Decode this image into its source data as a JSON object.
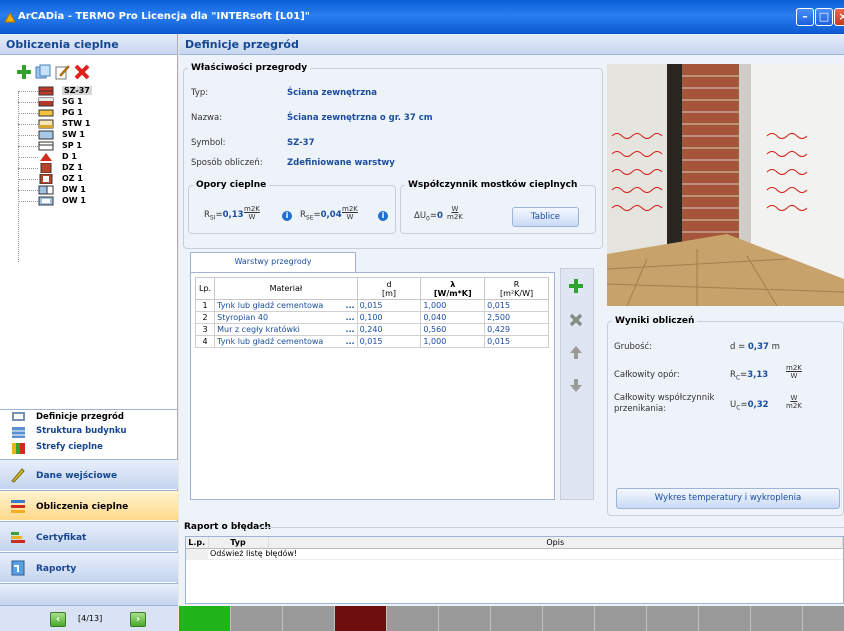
{
  "window": {
    "title": "ArCADia - TERMO Pro Licencja dla \"INTERsoft [L01]\""
  },
  "left_panel": {
    "header": "Obliczenia cieplne",
    "tree": [
      {
        "label": "SZ-37",
        "icon": "wall-icon",
        "selected": true
      },
      {
        "label": "SG 1",
        "icon": "wall-icon"
      },
      {
        "label": "PG 1",
        "icon": "floor-icon"
      },
      {
        "label": "STW 1",
        "icon": "ceiling-icon"
      },
      {
        "label": "SW 1",
        "icon": "internal-wall-icon"
      },
      {
        "label": "SP 1",
        "icon": "slab-icon"
      },
      {
        "label": "D 1",
        "icon": "roof-icon"
      },
      {
        "label": "DZ 1",
        "icon": "door-icon"
      },
      {
        "label": "OZ 1",
        "icon": "window-icon"
      },
      {
        "label": "DW 1",
        "icon": "internal-door-icon"
      },
      {
        "label": "OW 1",
        "icon": "internal-window-icon"
      }
    ],
    "subnav": [
      {
        "label": "Definicje przegród"
      },
      {
        "label": "Struktura budynku"
      },
      {
        "label": "Strefy cieplne"
      }
    ],
    "nav": [
      {
        "label": "Dane wejściowe"
      },
      {
        "label": "Obliczenia cieplne"
      },
      {
        "label": "Certyfikat"
      },
      {
        "label": "Raporty"
      }
    ],
    "pager": "[4/13]"
  },
  "main": {
    "header": "Definicje przegród",
    "properties": {
      "legend": "Właściwości przegrody",
      "type_label": "Typ:",
      "type_value": "Ściana zewnętrzna",
      "name_label": "Nazwa:",
      "name_value": "Ściana zewnętrzna o gr. 37 cm",
      "symbol_label": "Symbol:",
      "symbol_value": "SZ-37",
      "method_label": "Sposób obliczeń:",
      "method_value": "Zdefiniowane warstwy"
    },
    "thermal": {
      "legend": "Opory cieplne",
      "rsi_label": "R",
      "rsi_sub": "SI",
      "rsi_value": "0,13",
      "rsi_unit_num": "m2K",
      "rsi_unit_den": "W",
      "rse_label": "R",
      "rse_sub": "SE",
      "rse_value": "0,04",
      "rse_unit_num": "m2K",
      "rse_unit_den": "W"
    },
    "bridges": {
      "legend": "Współczynnik mostków cieplnych",
      "du_label": "ΔU",
      "du_sub": "0",
      "du_value": "0",
      "du_unit_num": "W",
      "du_unit_den": "m2K",
      "tables_button": "Tablice"
    },
    "layers": {
      "tab": "Warstwy przegrody",
      "columns": [
        "Lp.",
        "Materiał",
        "d",
        "[m]",
        "λ",
        "[W/m*K]",
        "R",
        "[m²K/W]"
      ],
      "rows": [
        {
          "lp": "1",
          "material": "Tynk lub gładź cementowa",
          "d": "0,015",
          "lambda": "1,000",
          "r": "0,015"
        },
        {
          "lp": "2",
          "material": "Styropian 40",
          "d": "0,100",
          "lambda": "0,040",
          "r": "2,500"
        },
        {
          "lp": "3",
          "material": "Mur z cegły kratówki",
          "d": "0,240",
          "lambda": "0,560",
          "r": "0,429"
        },
        {
          "lp": "4",
          "material": "Tynk lub gładź cementowa",
          "d": "0,015",
          "lambda": "1,000",
          "r": "0,015"
        }
      ],
      "dots": "..."
    },
    "results": {
      "legend": "Wyniki obliczeń",
      "thickness_label": "Grubość:",
      "thickness_sym": "d = ",
      "thickness_value": "0,37",
      "thickness_unit": "m",
      "resistance_label": "Całkowity opór:",
      "resistance_sym": "R",
      "resistance_sub": "C",
      "resistance_value": "3,13",
      "resistance_unit_num": "m2K",
      "resistance_unit_den": "W",
      "transfer_label": "Całkowity współczynnik przenikania:",
      "transfer_sym": "U",
      "transfer_sub": "C",
      "transfer_value": "0,32",
      "transfer_unit_num": "W",
      "transfer_unit_den": "m2K",
      "chart_button": "Wykres temperatury i wykroplenia"
    },
    "errors": {
      "legend": "Raport o błędach",
      "columns": [
        "L.p.",
        "Typ",
        "Opis"
      ],
      "message": "Odśwież listę błędów!"
    }
  }
}
